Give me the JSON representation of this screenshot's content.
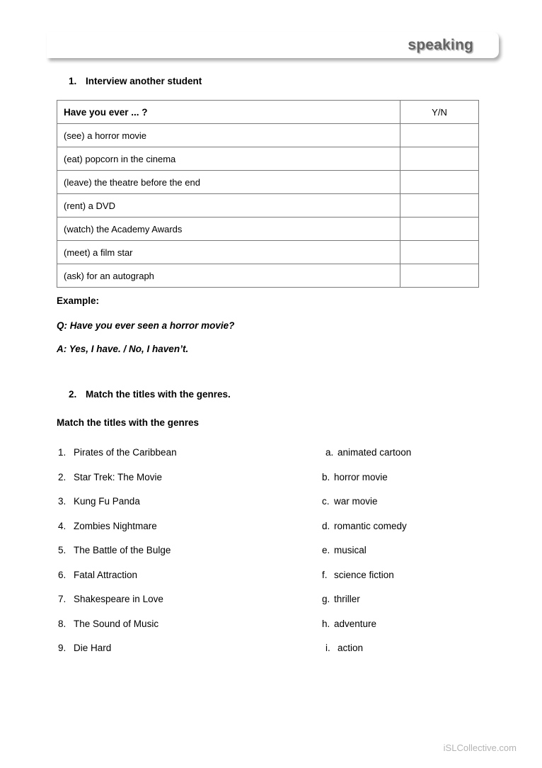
{
  "banner": {
    "title": "speaking",
    "title_color": "#636363"
  },
  "task1": {
    "number": "1.",
    "heading": "Interview another student",
    "table": {
      "headers": [
        "Have you ever ... ?",
        "Y/N"
      ],
      "rows": [
        "(see) a horror movie",
        "(eat) popcorn in the cinema",
        "(leave) the theatre before the end",
        "(rent) a DVD",
        "(watch) the Academy Awards",
        "(meet) a film star",
        "(ask) for an autograph"
      ]
    },
    "example": {
      "label": "Example:",
      "question": "Q: Have you ever seen a horror movie?",
      "answer": "A: Yes, I have. / No, I haven’t."
    }
  },
  "task2": {
    "number": "2.",
    "heading": "Match the titles with the genres.",
    "subheading": "Match the titles with the genres",
    "titles": [
      {
        "marker": "1.",
        "label": "Pirates of the Caribbean"
      },
      {
        "marker": "2.",
        "label": "Star Trek: The Movie"
      },
      {
        "marker": "3.",
        "label": "Kung Fu Panda"
      },
      {
        "marker": "4.",
        "label": "Zombies Nightmare"
      },
      {
        "marker": "5.",
        "label": "The Battle of the Bulge"
      },
      {
        "marker": "6.",
        "label": "Fatal Attraction"
      },
      {
        "marker": "7.",
        "label": "Shakespeare in Love"
      },
      {
        "marker": "8.",
        "label": "The Sound of Music"
      },
      {
        "marker": "9.",
        "label": "Die Hard"
      }
    ],
    "genres": [
      {
        "marker": "a.",
        "label": "animated cartoon"
      },
      {
        "marker": "b.",
        "label": "horror movie"
      },
      {
        "marker": "c.",
        "label": "war movie"
      },
      {
        "marker": "d.",
        "label": "romantic comedy"
      },
      {
        "marker": "e.",
        "label": "musical"
      },
      {
        "marker": "f.",
        "label": "science fiction"
      },
      {
        "marker": "g.",
        "label": "thriller"
      },
      {
        "marker": "h.",
        "label": "adventure"
      },
      {
        "marker": "i.",
        "label": "action"
      }
    ]
  },
  "footer": {
    "watermark": "iSLCollective.com"
  }
}
